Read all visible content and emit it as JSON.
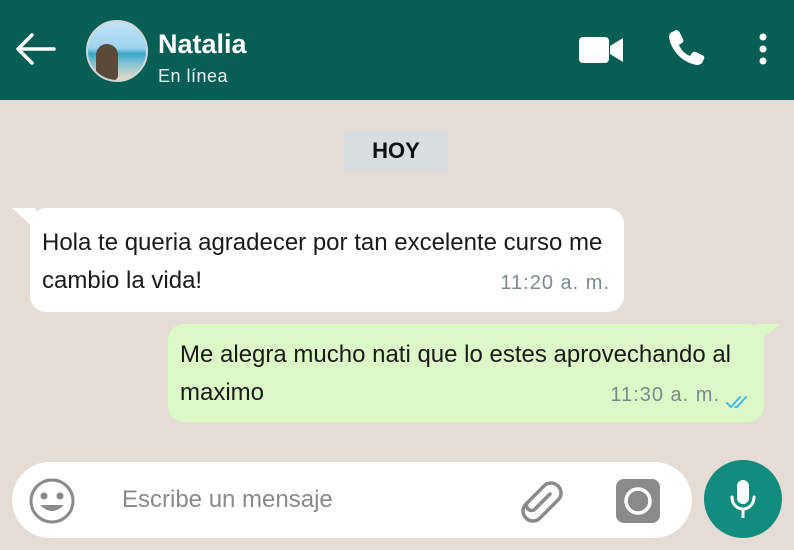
{
  "header": {
    "contact_name": "Natalia",
    "status": "En línea",
    "icons": [
      "back-arrow-icon",
      "video-call-icon",
      "phone-icon",
      "menu-icon"
    ]
  },
  "chat": {
    "date_chip": "HOY",
    "messages": [
      {
        "direction": "incoming",
        "text": "Hola te queria agradecer por tan excelente curso me cambio la vida!",
        "time": "11:20 a. m."
      },
      {
        "direction": "outgoing",
        "text": "Me alegra mucho nati que lo estes aprovechando al maximo",
        "time": "11:30 a. m.",
        "read": true
      }
    ]
  },
  "composer": {
    "placeholder": "Escribe un mensaje",
    "value": ""
  },
  "colors": {
    "header_bg": "#075e54",
    "chat_bg": "#e5ddd5",
    "outgoing_bubble": "#dcf8c6",
    "incoming_bubble": "#ffffff",
    "mic_button": "#128c7e",
    "read_ticks": "#34b7f1"
  }
}
